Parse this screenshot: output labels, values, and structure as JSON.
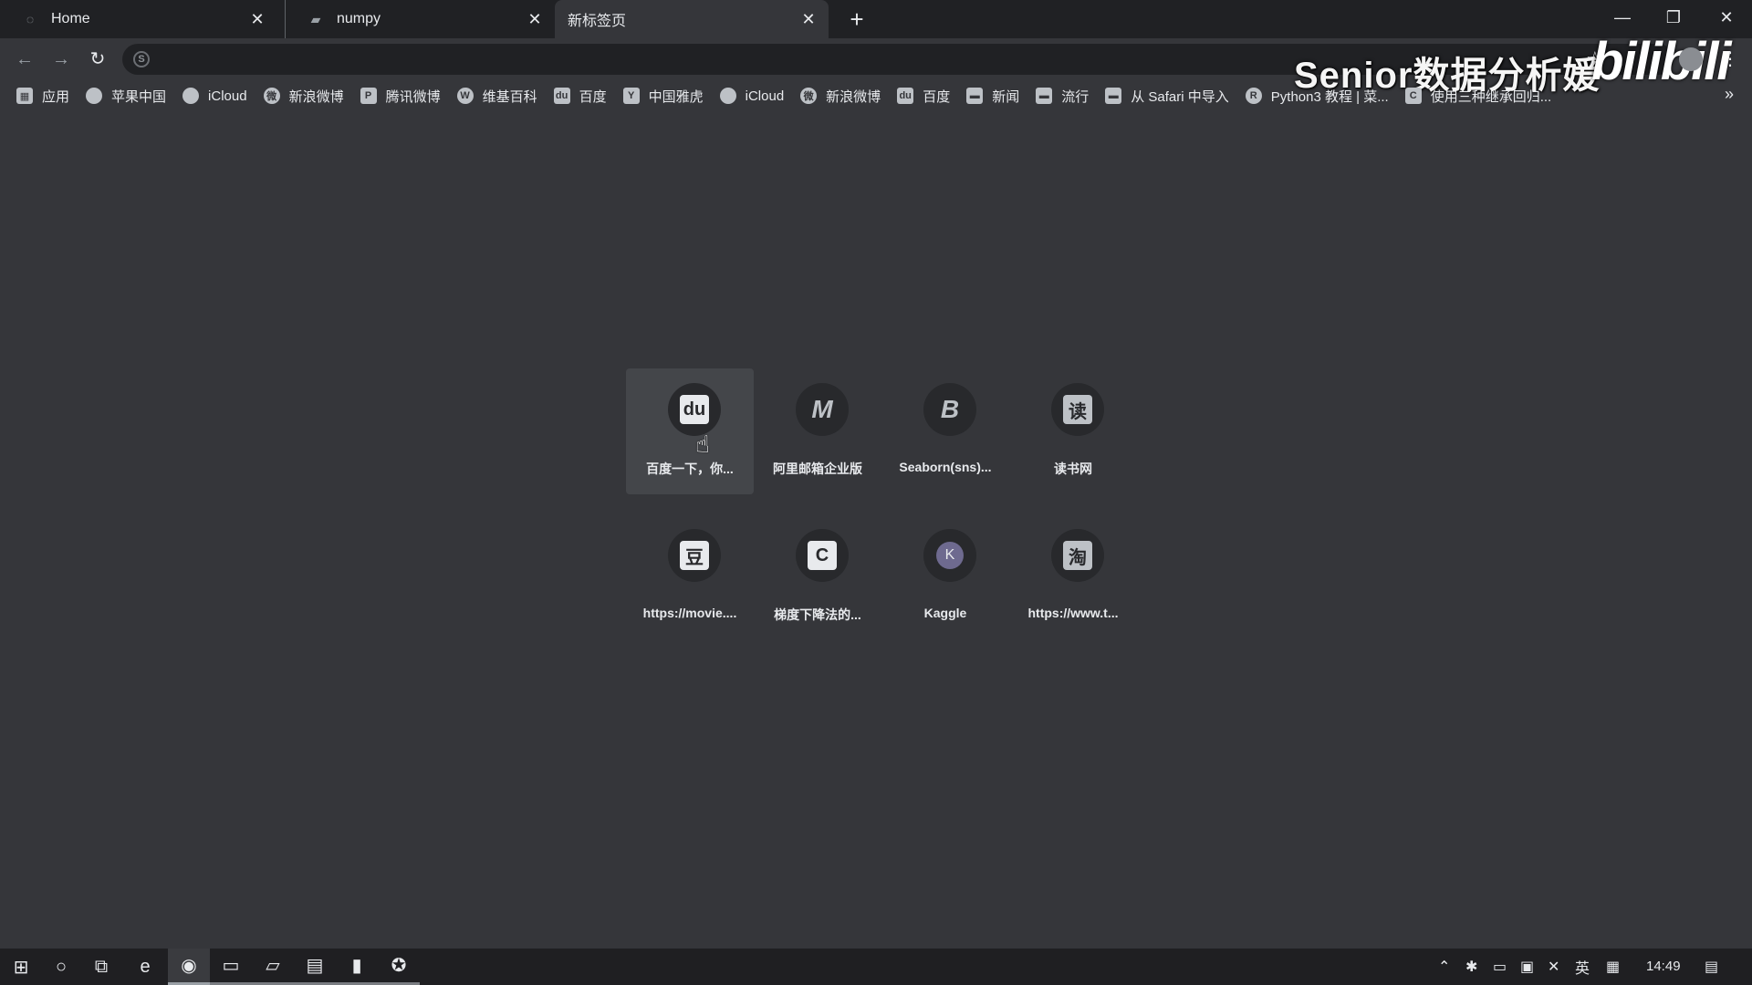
{
  "tabs": [
    {
      "title": "Home",
      "icon": "loading-spinner-icon"
    },
    {
      "title": "numpy",
      "icon": "page-icon"
    },
    {
      "title": "新标签页",
      "icon": ""
    }
  ],
  "toolbar": {
    "address_value": "",
    "watermark": "Senior数据分析媛",
    "logo": "bilibili"
  },
  "bookmarks": [
    {
      "label": "应用",
      "icon": "apps-grid-icon"
    },
    {
      "label": "苹果中国",
      "icon": "apple-icon"
    },
    {
      "label": "iCloud",
      "icon": "apple-icon"
    },
    {
      "label": "新浪微博",
      "icon": "weibo-icon"
    },
    {
      "label": "腾讯微博",
      "icon": "tencent-weibo-icon"
    },
    {
      "label": "维基百科",
      "icon": "globe-icon"
    },
    {
      "label": "百度",
      "icon": "baidu-icon"
    },
    {
      "label": "中国雅虎",
      "icon": "yahoo-icon"
    },
    {
      "label": "iCloud",
      "icon": "apple-icon"
    },
    {
      "label": "新浪微博",
      "icon": "weibo-icon"
    },
    {
      "label": "百度",
      "icon": "baidu-icon"
    },
    {
      "label": "新闻",
      "icon": "folder-icon"
    },
    {
      "label": "流行",
      "icon": "folder-icon"
    },
    {
      "label": "从 Safari 中导入",
      "icon": "folder-icon"
    },
    {
      "label": "Python3 教程 | 菜...",
      "icon": "runoob-icon"
    },
    {
      "label": "使用三种继承回归...",
      "icon": "csdn-icon"
    }
  ],
  "shortcuts": [
    {
      "label": "百度一下，你...",
      "icon": "baidu-icon",
      "glyph": "du"
    },
    {
      "label": "阿里邮箱企业版",
      "icon": "aliyun-mail-icon",
      "glyph": "M"
    },
    {
      "label": "Seaborn(sns)...",
      "icon": "seaborn-icon",
      "glyph": "B"
    },
    {
      "label": "读书网",
      "icon": "dushu-icon",
      "glyph": "读"
    },
    {
      "label": "https://movie....",
      "icon": "douban-icon",
      "glyph": "豆"
    },
    {
      "label": "梯度下降法的...",
      "icon": "csdn-icon",
      "glyph": "C"
    },
    {
      "label": "Kaggle",
      "icon": "kaggle-icon",
      "glyph": "K"
    },
    {
      "label": "https://www.t...",
      "icon": "taobao-icon",
      "glyph": "淘"
    }
  ],
  "taskbar": {
    "clock": "14:49",
    "ime": "英"
  }
}
